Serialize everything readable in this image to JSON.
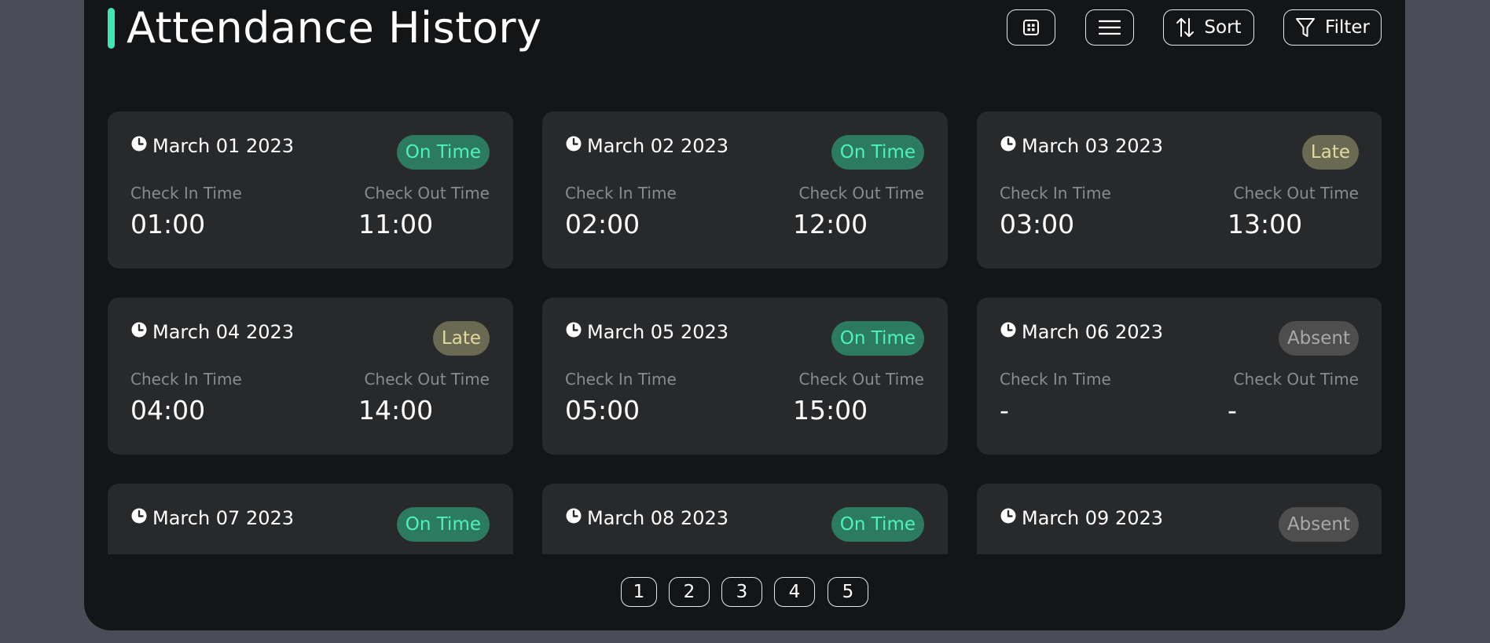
{
  "page": {
    "title": "Attendance History",
    "accent_color": "#3ee9b1"
  },
  "toolbar": {
    "grid_view_icon": "grid-view-icon",
    "list_view_icon": "menu-lines-icon",
    "sort_label": "Sort",
    "sort_icon": "sort-arrows-icon",
    "filter_label": "Filter",
    "filter_icon": "funnel-icon"
  },
  "labels": {
    "check_in": "Check In Time",
    "check_out": "Check Out Time"
  },
  "records": [
    {
      "date": "March 01 2023",
      "status": "On Time",
      "status_type": "ontime",
      "check_in": "01:00",
      "check_out": "11:00"
    },
    {
      "date": "March 02 2023",
      "status": "On Time",
      "status_type": "ontime",
      "check_in": "02:00",
      "check_out": "12:00"
    },
    {
      "date": "March 03 2023",
      "status": "Late",
      "status_type": "late",
      "check_in": "03:00",
      "check_out": "13:00"
    },
    {
      "date": "March 04 2023",
      "status": "Late",
      "status_type": "late",
      "check_in": "04:00",
      "check_out": "14:00"
    },
    {
      "date": "March 05 2023",
      "status": "On Time",
      "status_type": "ontime",
      "check_in": "05:00",
      "check_out": "15:00"
    },
    {
      "date": "March 06 2023",
      "status": "Absent",
      "status_type": "absent",
      "check_in": "-",
      "check_out": "-"
    },
    {
      "date": "March 07 2023",
      "status": "On Time",
      "status_type": "ontime",
      "check_in": "",
      "check_out": ""
    },
    {
      "date": "March 08 2023",
      "status": "On Time",
      "status_type": "ontime",
      "check_in": "",
      "check_out": ""
    },
    {
      "date": "March 09 2023",
      "status": "Absent",
      "status_type": "absent",
      "check_in": "",
      "check_out": ""
    }
  ],
  "status_colors": {
    "ontime": {
      "bg": "#2c7a60",
      "fg": "#4ff2bd"
    },
    "late": {
      "bg": "#6a6a52",
      "fg": "#e1d9a0"
    },
    "absent": {
      "bg": "#4e4e4e",
      "fg": "#a9a9a9"
    }
  },
  "pagination": {
    "pages": [
      "1",
      "2",
      "3",
      "4",
      "5"
    ]
  }
}
